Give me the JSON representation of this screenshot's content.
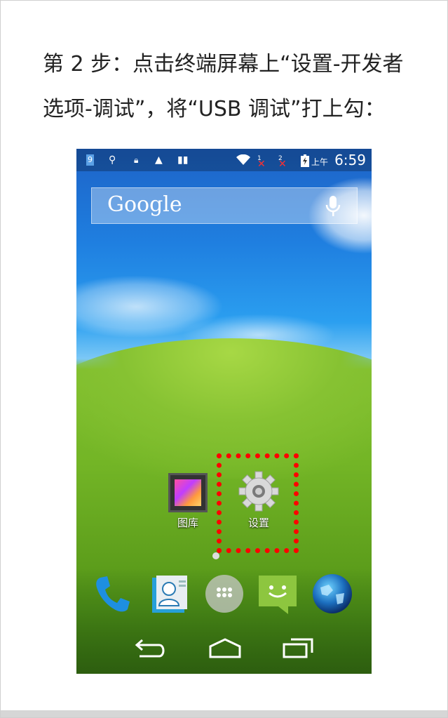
{
  "instruction": {
    "line1": "第 2 步：点击终端屏幕上“设置-开发者",
    "line2": "选项-调试”，将“USB 调试”打上勾："
  },
  "screenshot": {
    "status_bar": {
      "ampm": "上午",
      "time": "6:59",
      "sim1_label": "1",
      "sim2_label": "2"
    },
    "google_search": {
      "logo_text": "Google"
    },
    "apps": [
      {
        "label": "图库",
        "icon": "gallery-icon"
      },
      {
        "label": "设置",
        "icon": "settings-gear-icon"
      }
    ],
    "dock": [
      {
        "icon": "phone-icon"
      },
      {
        "icon": "contacts-icon"
      },
      {
        "icon": "app-drawer-icon"
      },
      {
        "icon": "messaging-icon"
      },
      {
        "icon": "browser-globe-icon"
      }
    ],
    "nav": [
      {
        "icon": "back-icon"
      },
      {
        "icon": "home-icon"
      },
      {
        "icon": "recent-apps-icon"
      }
    ],
    "highlight_color": "#ff0000"
  }
}
